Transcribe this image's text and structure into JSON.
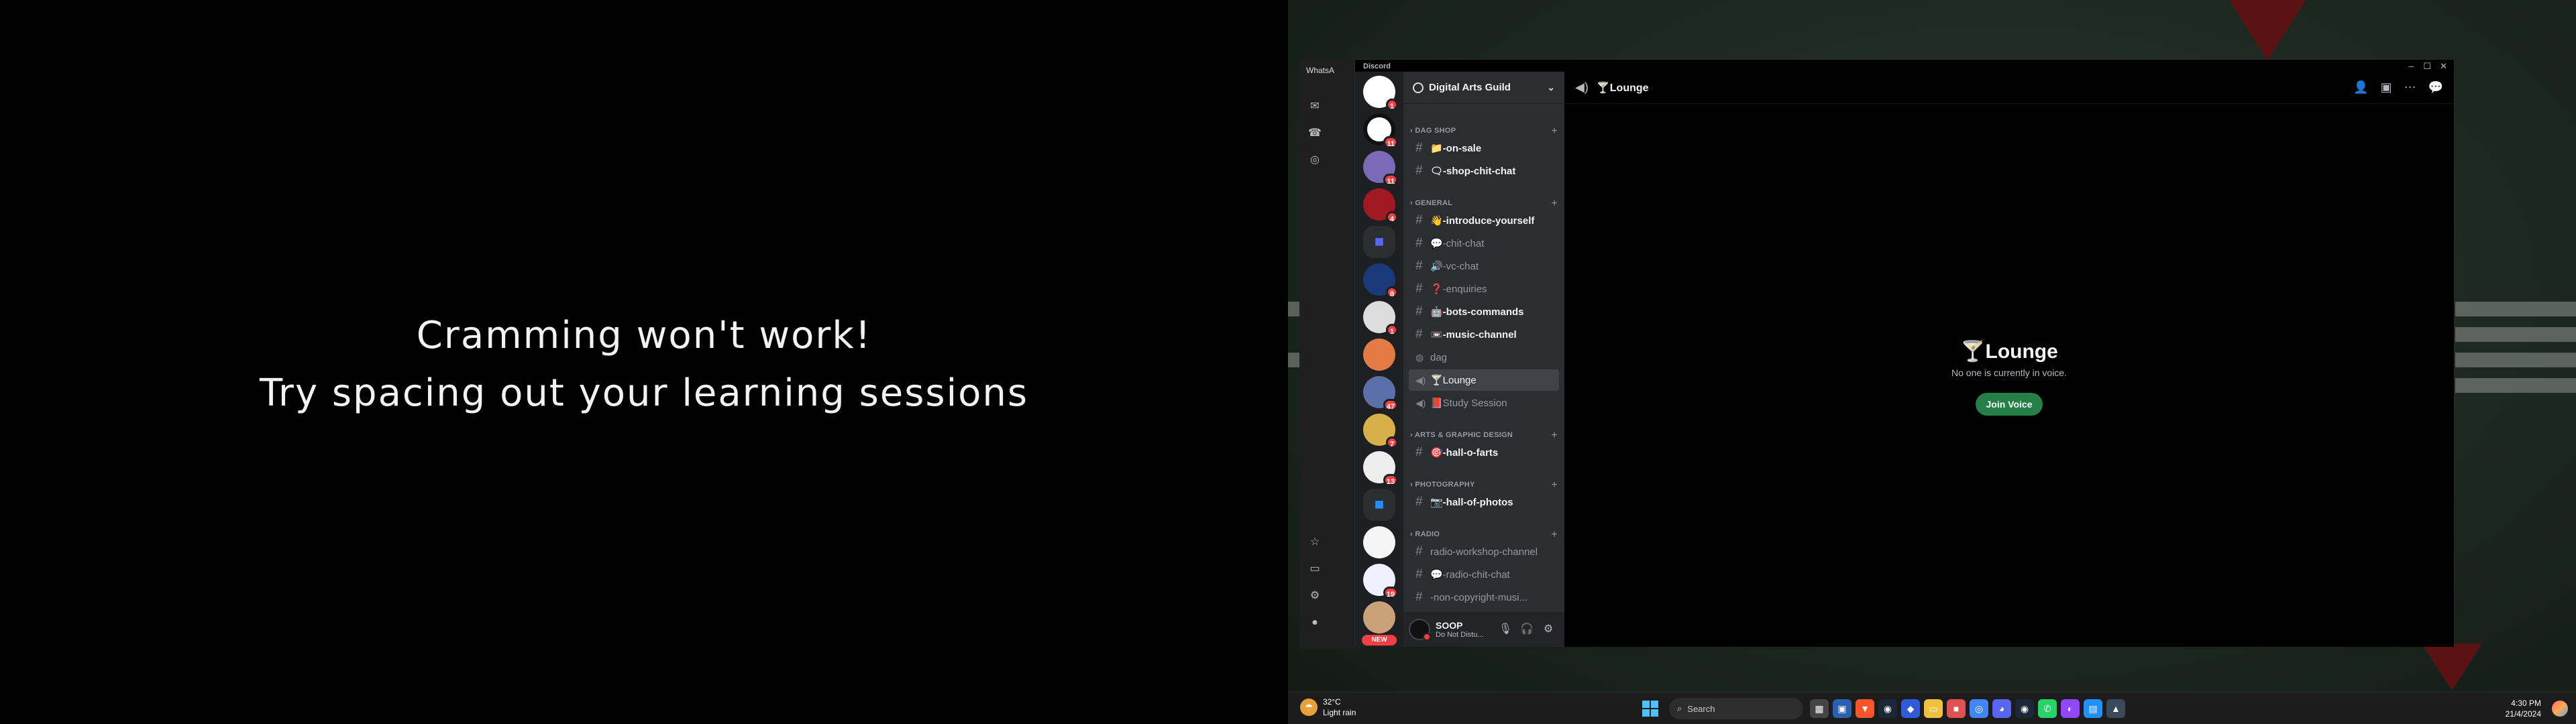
{
  "left_screen": {
    "line1": "Cramming won't work!",
    "line2": "Try spacing out your learning sessions"
  },
  "whatsapp": {
    "title": "WhatsA"
  },
  "discord": {
    "app_title": "Discord",
    "server_name": "Digital Arts Guild",
    "server_badges": [
      "1",
      "11",
      "11",
      "4",
      "",
      "8",
      "1",
      "",
      "47",
      "7",
      "13",
      "",
      "",
      "19",
      ""
    ],
    "new_label": "NEW",
    "categories": {
      "dag_shop": "DAG SHOP",
      "general": "GENERAL",
      "arts": "ARTS & GRAPHIC DESIGN",
      "photography": "PHOTOGRAPHY",
      "radio": "RADIO"
    },
    "channels": {
      "on_sale": "📁-on-sale",
      "shop_chit_chat": "🗨-shop-chit-chat",
      "introduce": "👋-introduce-yourself",
      "chit_chat": "💬-chit-chat",
      "vc_chat": "🔊-vc-chat",
      "enquiries": "❓-enquiries",
      "bots": "🤖-bots-commands",
      "music": "📼-music-channel",
      "dag": "dag",
      "lounge": "🍸Lounge",
      "study": "📕Study Session",
      "hall_o_farts": "🎯-hall-o-farts",
      "hall_of_photos": "📷-hall-of-photos",
      "radio_workshop": "radio-workshop-channel",
      "radio_chit": "💬-radio-chit-chat",
      "non_copyright": "-non-copyright-musi..."
    },
    "user": {
      "name": "SOOP",
      "status": "Do Not Distu..."
    },
    "header_title": "🍸Lounge",
    "voice": {
      "title": "🍸Lounge",
      "subtitle": "No one is currently in voice.",
      "join_label": "Join Voice"
    }
  },
  "taskbar": {
    "temperature": "32°C",
    "weather": "Light rain",
    "search_placeholder": "Search",
    "time": "4:30 PM",
    "date": "21/4/2024"
  },
  "colors": {
    "accent_green": "#248046",
    "badge_red": "#f23f43",
    "windows_blue": "#4cc2ff"
  }
}
